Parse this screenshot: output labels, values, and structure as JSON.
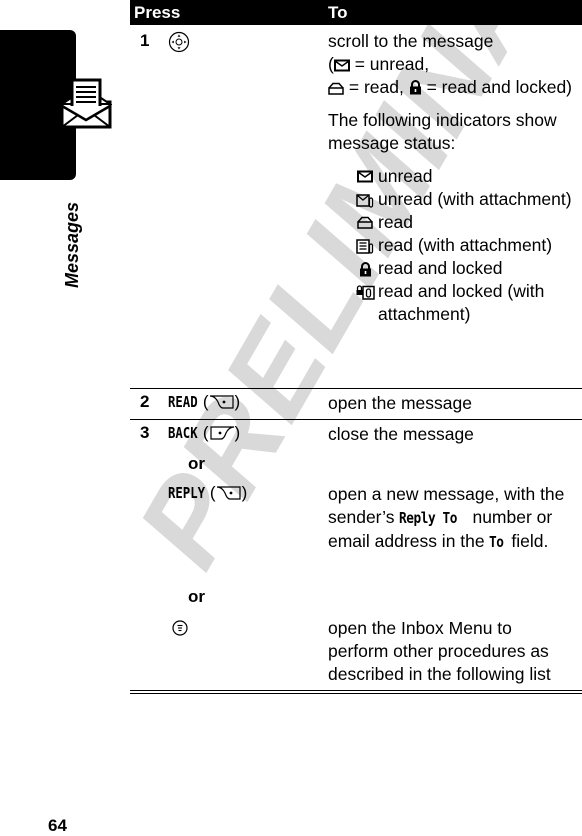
{
  "section": {
    "label": "Messages",
    "page_number": "64",
    "icon": "open-envelope-with-letter-icon"
  },
  "watermark": "PRELIMINARY",
  "table": {
    "headers": {
      "press": "Press",
      "to": "To"
    },
    "rows": [
      {
        "step": "1",
        "press_icon": "nav-key-icon",
        "to_intro": "scroll to the message",
        "legend": {
          "open_paren": "(",
          "unread_eq": " = unread,",
          "read_eq": " = read, ",
          "locked_eq": " = read and locked)"
        },
        "indicators_intro": "The following indicators show message status:",
        "indicators": [
          {
            "icon": "unread-envelope-icon",
            "label": "unread"
          },
          {
            "icon": "unread-attachment-icon",
            "label": "unread (with attachment)"
          },
          {
            "icon": "read-open-envelope-icon",
            "label": "read"
          },
          {
            "icon": "read-attachment-icon",
            "label": "read (with attachment)"
          },
          {
            "icon": "lock-icon",
            "label": "read and locked"
          },
          {
            "icon": "locked-attachment-icon",
            "label": "read and locked (with attachment)"
          }
        ]
      },
      {
        "step": "2",
        "press_key": "READ",
        "press_icon": "left-soft-key-icon",
        "to": "open the message"
      },
      {
        "step": "3",
        "options": [
          {
            "press_key": "BACK",
            "press_icon": "right-soft-key-icon",
            "to": "close the message"
          },
          {
            "connector": "or"
          },
          {
            "press_key": "REPLY",
            "press_icon": "left-soft-key-icon",
            "to_before": "open a new message, with the sender’s ",
            "to_key1": "Reply To",
            "to_mid": " number or email address in the ",
            "to_key2": "To",
            "to_after": " field."
          },
          {
            "connector": "or"
          },
          {
            "press_icon": "menu-key-icon",
            "to": "open the Inbox Menu to perform other procedures as described in the following list"
          }
        ]
      }
    ]
  }
}
